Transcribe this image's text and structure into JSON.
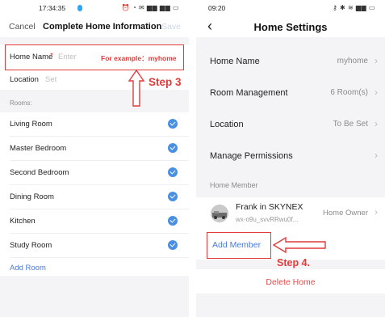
{
  "left": {
    "status_time": "17:34:35",
    "status_icons": "⏰ ◔ ✉ ▆▆ ▆▆ ▭",
    "cancel": "Cancel",
    "title": "Complete Home Information",
    "save": "Save",
    "home_name_label": "Home Name",
    "required_mark": "*",
    "home_name_placeholder": "Enter",
    "example_note": "For example：myhome",
    "location_label": "Location",
    "location_placeholder": "Set",
    "rooms_header": "Rooms:",
    "rooms": [
      "Living Room",
      "Master Bedroom",
      "Second Bedroom",
      "Dining Room",
      "Kitchen",
      "Study Room"
    ],
    "add_room": "Add Room",
    "step_label": "Step 3"
  },
  "right": {
    "status_time": "09:20",
    "status_icons": "⚷ ✱ ≋ ▆▆ ▭",
    "back": "‹",
    "title": "Home Settings",
    "home_name_label": "Home Name",
    "home_name_value": "myhome",
    "room_mgmt_label": "Room Management",
    "room_mgmt_value": "6 Room(s)",
    "location_label": "Location",
    "location_value": "To Be Set",
    "permissions_label": "Manage Permissions",
    "home_member_header": "Home Member",
    "member_name": "Frank in SKYNEX",
    "member_id": "wx-o9u_svvRRwu0f...",
    "member_role": "Home Owner",
    "add_member": "Add Member",
    "delete_home": "Delete Home",
    "step_label": "Step 4."
  },
  "colors": {
    "accent": "#4a90e2",
    "annotation": "#e23b3b",
    "delete": "#e84a4a",
    "background": "#f4f4f6"
  }
}
